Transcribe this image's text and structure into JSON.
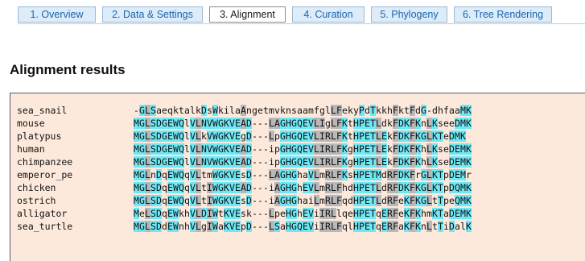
{
  "tabs": [
    {
      "label": "1. Overview",
      "active": false
    },
    {
      "label": "2. Data & Settings",
      "active": false
    },
    {
      "label": "3. Alignment",
      "active": true
    },
    {
      "label": "4. Curation",
      "active": false
    },
    {
      "label": "5. Phylogeny",
      "active": false
    },
    {
      "label": "6. Tree Rendering",
      "active": false
    }
  ],
  "section_title": "Alignment results",
  "colors": {
    "conserved": "#6fe8f6",
    "similar": "#b8b8b8",
    "panel_bg": "#fde9dc",
    "tab_bg": "#dcecf8",
    "tab_text": "#1d63b0"
  },
  "alignment": {
    "sequences": [
      {
        "name": "sea_snail",
        "seq": "-GLSaeqktalkDsWkilaAngetmvknsaamfglLFekyPdTkkhFktFdG-dhfaaMK"
      },
      {
        "name": "mouse",
        "seq": "MGLSDGEWQlVLNVWGKVEAD---LAGHGQEVLIgLFKtHPETLdkFDKFKnLKseeDMK"
      },
      {
        "name": "platypus",
        "seq": "MGLSDGEWQlVLkVWGKVEgD---LpGHGQEVLIRLFKtHPETLEkFDKFKGLKTeDMK"
      },
      {
        "name": "human",
        "seq": "MGLSDGEWQlVLNVWGKVEAD---ipGHGQEVLIRLFKgHPETLEkFDKFKhLKseDEMK"
      },
      {
        "name": "chimpanzee",
        "seq": "MGLSDGEWQlVLNVWGKVEAD---ipGHGQEVLIRLFKgHPETLEkFDKFKhLKseDEMK"
      },
      {
        "name": "emperor_pe",
        "seq": "MGLnDqEWQqVLtmWGKVEsD---LAGHGhaVLmRLFKsHPETMdRFDKFrGLKTpDEMr"
      },
      {
        "name": "chicken",
        "seq": "MGLSDqEWQqVLtIWGKVEAD---iAGHGhEVLmRLFhdHPETLdRFDKFKGLKTpDQMK"
      },
      {
        "name": "ostrich",
        "seq": "MGLSDqEWQqVLtIWGKVEsD---iAGHGhaiLmRLFqdHPETLdRFeKFKGLtTpeQMK"
      },
      {
        "name": "alligator",
        "seq": "MeLSDqEWkhVLDIWtKVEsk---LpeHGhEViIRLlqeHPETqERFeKFKhmKTaDEMK"
      },
      {
        "name": "sea_turtle",
        "seq": "MGLSDdEWnhVLgIWaKVEpD---LSaHGQEViIRLFqlHPETqERFaKFKnLtTiDalK"
      }
    ]
  }
}
